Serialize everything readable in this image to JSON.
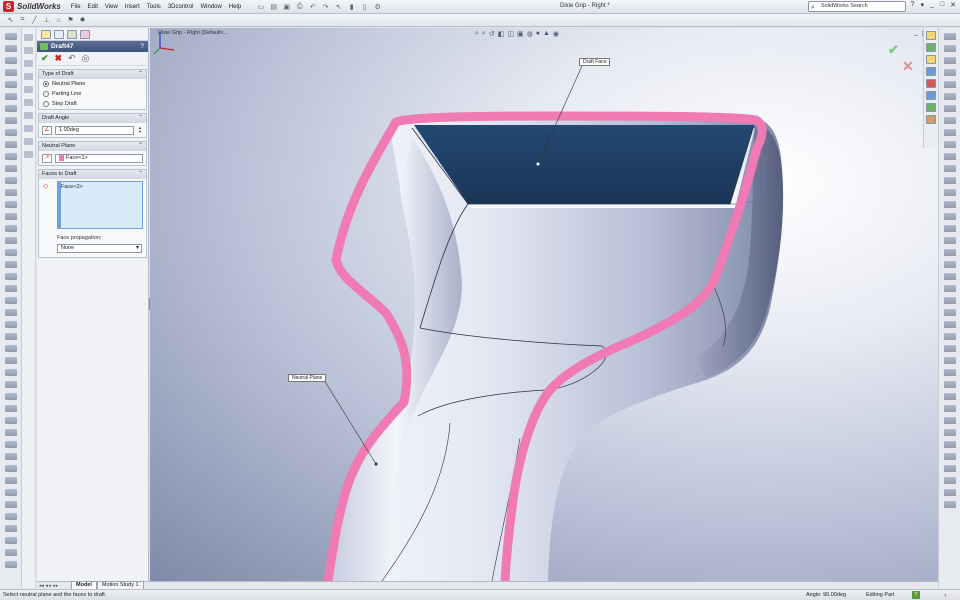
{
  "app": {
    "logo_text": "SolidWorks",
    "logo_glyph": "S",
    "menu": [
      "File",
      "Edit",
      "View",
      "Insert",
      "Tools",
      "3Dcontrol",
      "Window",
      "Help"
    ],
    "doc_title": "Dixie Grip - Right *",
    "search_placeholder": "SolidWorks Search",
    "window_buttons": [
      "?",
      "▾",
      "_",
      "□",
      "✕"
    ]
  },
  "property_manager": {
    "title": "Draft47",
    "help": "?",
    "groups": {
      "type": {
        "label": "Type of Draft",
        "options": [
          "Neutral Plane",
          "Parting Line",
          "Step Draft"
        ],
        "selected": "Neutral Plane"
      },
      "angle": {
        "label": "Draft Angle",
        "value": "1.00deg"
      },
      "neutral": {
        "label": "Neutral Plane",
        "value": "Face<1>"
      },
      "faces": {
        "label": "Faces to Draft",
        "items": [
          "Face<2>"
        ],
        "propagation_label": "Face propagation:",
        "propagation_value": "None"
      }
    }
  },
  "viewport": {
    "tree_label": "Dixie Grip - Right  (Default<...",
    "callouts": {
      "draft_face": "Draft Face",
      "neutral_plane": "Neutral Plane"
    },
    "controls": [
      "_",
      "▯",
      "✕"
    ],
    "colors": {
      "draft_face": "#1f3f66",
      "neutral_edge": "#f07ab4",
      "part_light": "#f4f6fb",
      "part_dark": "#8d97b4"
    }
  },
  "tabs": {
    "items": [
      "Model",
      "Motion Study 1"
    ],
    "active": "Model"
  },
  "status": {
    "left": "Select neutral plane and the faces to draft.",
    "angle": "Angle: 90.00deg",
    "mode": "Editing Part",
    "help_glyph": "?"
  }
}
